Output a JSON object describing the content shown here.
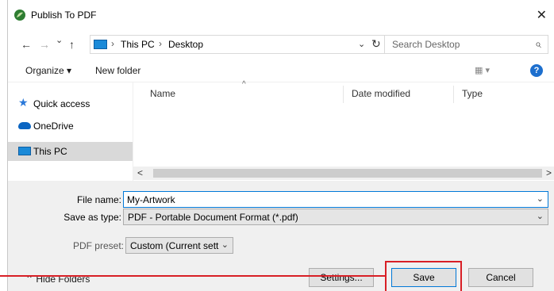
{
  "window": {
    "title": "Publish To PDF",
    "close_glyph": "✕"
  },
  "address_bar": {
    "back_glyph": "←",
    "forward_glyph": "→",
    "recent_glyph": "⌄",
    "up_glyph": "↑",
    "crumbs": [
      "This PC",
      "Desktop"
    ],
    "crumb_separator": "›",
    "dropdown_glyph": "⌄",
    "refresh_glyph": "↻",
    "search_placeholder": "Search Desktop",
    "search_glyph": "⌕"
  },
  "toolbar": {
    "organize_label": "Organize ▾",
    "new_folder_label": "New folder",
    "view_glyph": "▦ ▾",
    "help_glyph": "?"
  },
  "sidebar": {
    "items": [
      {
        "label": "Quick access",
        "icon": "star-icon"
      },
      {
        "label": "OneDrive",
        "icon": "cloud-icon"
      },
      {
        "label": "This PC",
        "icon": "computer-icon",
        "selected": true
      }
    ]
  },
  "file_list": {
    "columns": [
      "Name",
      "Date modified",
      "Type"
    ],
    "sort_glyph": "^",
    "scroll_left": "<",
    "scroll_right": ">"
  },
  "form": {
    "file_name_label": "File name:",
    "file_name_value": "My-Artwork",
    "save_as_type_label": "Save as type:",
    "save_as_type_value": "PDF - Portable Document Format (*.pdf)",
    "pdf_preset_label": "PDF preset:",
    "pdf_preset_value": "Custom (Current sett",
    "dropdown_glyph": "⌄"
  },
  "footer": {
    "hide_folders_label": "⌃  Hide Folders",
    "settings_label": "Settings...",
    "save_label": "Save",
    "cancel_label": "Cancel"
  },
  "colors": {
    "highlight": "#d81f26",
    "accent": "#0078d7"
  }
}
